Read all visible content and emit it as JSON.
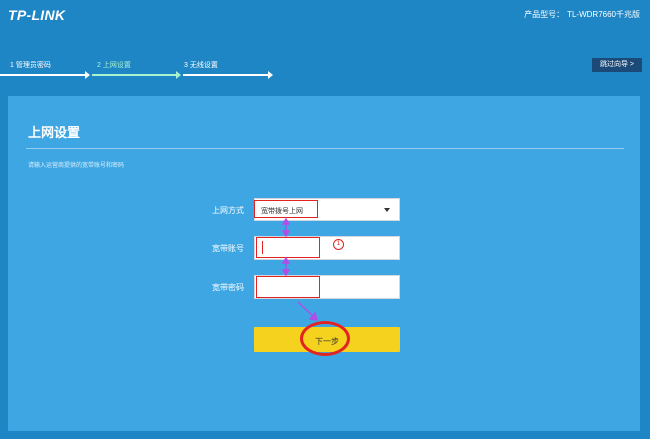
{
  "header": {
    "logo": "TP-LINK",
    "model_label": "产品型号：",
    "model_value": "TL-WDR7660千兆版"
  },
  "steps": [
    {
      "label": "1 管理员密码",
      "active": false
    },
    {
      "label": "2 上网设置",
      "active": true
    },
    {
      "label": "3 无线设置",
      "active": false
    }
  ],
  "skip_label": "跳过向导 >",
  "panel": {
    "title": "上网设置",
    "description": "请输入运营商提供的宽带账号和密码"
  },
  "form": {
    "mode_label": "上网方式",
    "mode_value": "宽带拨号上网",
    "account_label": "宽带账号",
    "account_value": "",
    "password_label": "宽带密码",
    "password_value": "",
    "next_label": "下一步"
  },
  "annotations": {
    "marker_text": "1"
  },
  "colors": {
    "header_bg": "#1f86c6",
    "panel_bg": "#3ea7e3",
    "active_step": "#a7f3d0",
    "button": "#f5d21e",
    "annotation_red": "#e32222",
    "annotation_arrow": "#b14de8"
  }
}
